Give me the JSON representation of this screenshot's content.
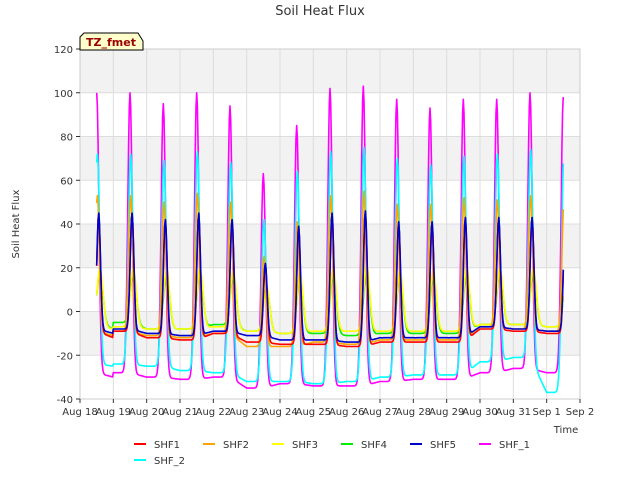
{
  "chart_data": {
    "type": "line",
    "title": "Soil Heat Flux",
    "xlabel": "Time",
    "ylabel": "Soil Heat Flux",
    "annotation": "TZ_fmet",
    "ylim": [
      -40,
      120
    ],
    "yticks": [
      -40,
      -20,
      0,
      20,
      40,
      60,
      80,
      100,
      120
    ],
    "xlim": [
      0,
      15
    ],
    "xticks": [
      {
        "x": 0,
        "label": "Aug 18"
      },
      {
        "x": 1,
        "label": "Aug 19"
      },
      {
        "x": 2,
        "label": "Aug 20"
      },
      {
        "x": 3,
        "label": "Aug 21"
      },
      {
        "x": 4,
        "label": "Aug 22"
      },
      {
        "x": 5,
        "label": "Aug 23"
      },
      {
        "x": 6,
        "label": "Aug 24"
      },
      {
        "x": 7,
        "label": "Aug 25"
      },
      {
        "x": 8,
        "label": "Aug 26"
      },
      {
        "x": 9,
        "label": "Aug 27"
      },
      {
        "x": 10,
        "label": "Aug 28"
      },
      {
        "x": 11,
        "label": "Aug 29"
      },
      {
        "x": 12,
        "label": "Aug 30"
      },
      {
        "x": 13,
        "label": "Aug 31"
      },
      {
        "x": 14,
        "label": "Sep 1"
      },
      {
        "x": 15,
        "label": "Sep 2"
      }
    ],
    "grid": true,
    "banded_background": true,
    "legend_position": "bottom",
    "x_days": [
      1,
      2,
      3,
      4,
      5,
      6,
      7,
      8,
      9,
      10,
      11,
      12,
      13,
      14
    ],
    "series": [
      {
        "name": "SHF1",
        "color": "#ff0000",
        "peaks": [
          45,
          42,
          45,
          42,
          22,
          39,
          45,
          46,
          41,
          41,
          43,
          43,
          43,
          42
        ],
        "troughs": [
          -9,
          -12,
          -13,
          -10,
          -14,
          -15,
          -15,
          -16,
          -14,
          -14,
          -14,
          -8,
          -9,
          -10
        ]
      },
      {
        "name": "SHF2",
        "color": "#ffa500",
        "peaks": [
          53,
          50,
          54,
          50,
          25,
          41,
          53,
          55,
          49,
          49,
          52,
          51,
          53,
          50
        ],
        "troughs": [
          -9,
          -11,
          -12,
          -10,
          -16,
          -16,
          -14,
          -15,
          -13,
          -13,
          -13,
          -7,
          -8,
          -9
        ]
      },
      {
        "name": "SHF3",
        "color": "#ffff00",
        "peaks": [
          20,
          19,
          20,
          19,
          11,
          18,
          20,
          21,
          19,
          19,
          20,
          20,
          20,
          19
        ],
        "troughs": [
          -7,
          -8,
          -8,
          -7,
          -9,
          -10,
          -9,
          -9,
          -9,
          -9,
          -9,
          -6,
          -6,
          -7
        ]
      },
      {
        "name": "SHF4",
        "color": "#00ee00",
        "peaks": [
          18,
          17,
          18,
          17,
          11,
          16,
          18,
          19,
          17,
          17,
          18,
          18,
          18,
          17
        ],
        "troughs": [
          -5,
          -8,
          -8,
          -6,
          -9,
          -10,
          -10,
          -11,
          -10,
          -10,
          -10,
          -6,
          -6,
          -7
        ]
      },
      {
        "name": "SHF5",
        "color": "#0000cc",
        "peaks": [
          45,
          42,
          45,
          42,
          22,
          39,
          45,
          46,
          41,
          41,
          43,
          43,
          43,
          42
        ],
        "troughs": [
          -8,
          -10,
          -11,
          -9,
          -11,
          -13,
          -13,
          -14,
          -12,
          -12,
          -12,
          -7,
          -8,
          -9
        ]
      },
      {
        "name": "SHF_1",
        "color": "#ff00ff",
        "peaks": [
          100,
          95,
          100,
          94,
          63,
          85,
          102,
          103,
          97,
          93,
          97,
          97,
          100,
          98
        ],
        "troughs": [
          -28,
          -30,
          -31,
          -30,
          -35,
          -33,
          -34,
          -34,
          -32,
          -31,
          -31,
          -28,
          -26,
          -28
        ]
      },
      {
        "name": "SHF_2",
        "color": "#00ffff",
        "peaks": [
          72,
          69,
          73,
          68,
          42,
          64,
          73,
          75,
          70,
          67,
          71,
          72,
          74,
          72
        ],
        "troughs": [
          -24,
          -25,
          -27,
          -28,
          -32,
          -32,
          -33,
          -32,
          -30,
          -29,
          -29,
          -23,
          -21,
          -37
        ]
      }
    ]
  }
}
